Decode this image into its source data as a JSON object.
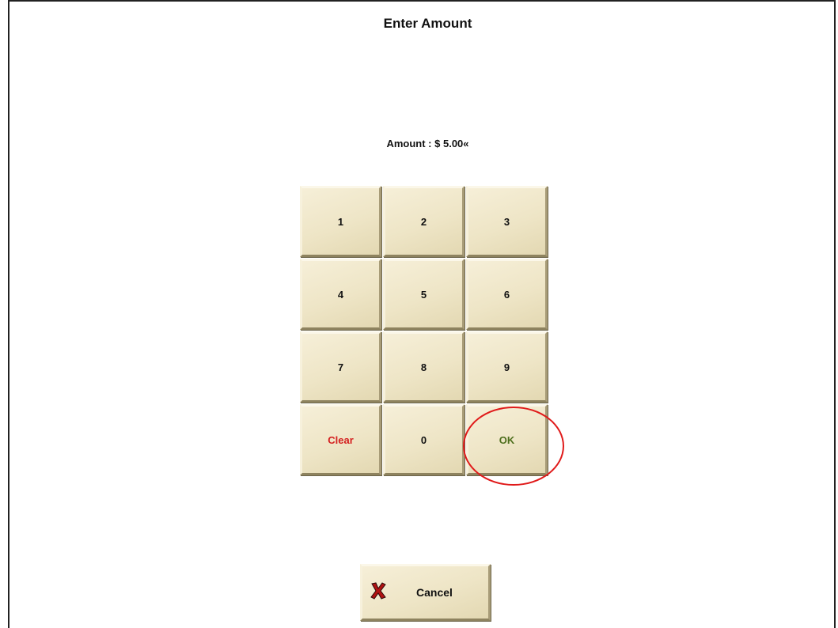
{
  "dialog": {
    "title": "Enter Amount",
    "amount_label": "Amount :",
    "amount_value": "$ 5.00«"
  },
  "keypad": {
    "keys": [
      {
        "label": "1"
      },
      {
        "label": "2"
      },
      {
        "label": "3"
      },
      {
        "label": "4"
      },
      {
        "label": "5"
      },
      {
        "label": "6"
      },
      {
        "label": "7"
      },
      {
        "label": "8"
      },
      {
        "label": "9"
      },
      {
        "label": "Clear"
      },
      {
        "label": "0"
      },
      {
        "label": "OK"
      }
    ]
  },
  "footer": {
    "cancel_label": "Cancel",
    "cancel_icon": "x-mark-icon"
  },
  "colors": {
    "button_face": "#eee5c6",
    "clear_text": "#d42020",
    "ok_text": "#4e6f1d",
    "highlight": "#e01a1a"
  }
}
